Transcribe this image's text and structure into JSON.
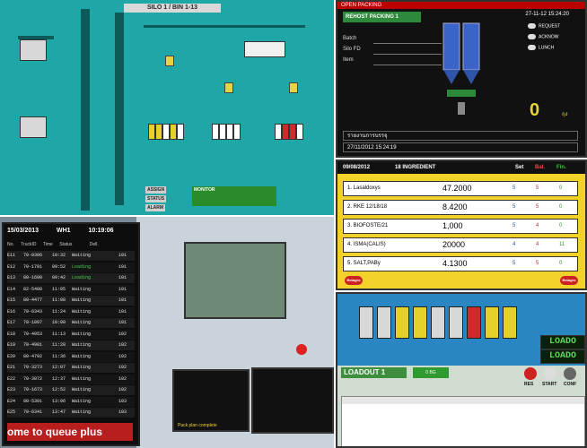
{
  "scada": {
    "title": "SILO 1 / BIN 1-13",
    "buttons": [
      "ASSIGN",
      "STATUS",
      "ALARM",
      "MONITOR"
    ],
    "hopper_colors": [
      "#e6d12a",
      "#ffffff",
      "#d02a2a",
      "#cfcfcf"
    ]
  },
  "packing": {
    "window_title": "OPEN PACKING",
    "header": "REHOST PACKING 1",
    "datetime": "27-11-12 15:24:20",
    "options": [
      "REQUEST",
      "ACKNOW",
      "LUNCH"
    ],
    "fields": [
      "Batch",
      "Silo FD",
      "Item"
    ],
    "count": "0",
    "unit": "ถุง",
    "status_label": "รายงานการบรรจุ",
    "timestamp": "27/11/2012 15:24:19"
  },
  "ingredients": {
    "date": "09/08/2012",
    "header": "18 INGREDIENT",
    "col_set": "Set",
    "col_bal": "Bal.",
    "col_fin": "Fin.",
    "rows": [
      {
        "name": "1. Lasaldoxys",
        "weight": "47.2000",
        "set": "5",
        "bal": "5",
        "fin": "0"
      },
      {
        "name": "2. RKE 12/18/18",
        "weight": "8.4200",
        "set": "5",
        "bal": "5",
        "fin": "0"
      },
      {
        "name": "3. BIOFOSTE/21",
        "weight": "1,000",
        "set": "5",
        "bal": "4",
        "fin": "0"
      },
      {
        "name": "4. ISMA(CALIS)",
        "weight": "20000",
        "set": "4",
        "bal": "4",
        "fin": "11"
      },
      {
        "name": "5. SALT,PABy",
        "weight": "4.1300",
        "set": "5",
        "bal": "5",
        "fin": "0"
      }
    ],
    "brand": "Betagro"
  },
  "queue": {
    "date": "15/03/2013",
    "warehouse": "WH1",
    "clock": "10:19:06",
    "columns": [
      "No.",
      "TruckID",
      "Time",
      "Status",
      "Dell."
    ],
    "rows": [
      {
        "no": "E11",
        "truck": "70-0306",
        "time": "10:32",
        "status": "Waiting",
        "dell": "101"
      },
      {
        "no": "E12",
        "truck": "70-1791",
        "time": "09:52",
        "status": "Loading",
        "dell": "101"
      },
      {
        "no": "E13",
        "truck": "80-1690",
        "time": "09:42",
        "status": "Loading",
        "dell": "101"
      },
      {
        "no": "E14",
        "truck": "82-5408",
        "time": "11:05",
        "status": "Waiting",
        "dell": "101"
      },
      {
        "no": "E15",
        "truck": "80-4477",
        "time": "11:08",
        "status": "Waiting",
        "dell": "101"
      },
      {
        "no": "E16",
        "truck": "70-6343",
        "time": "11:24",
        "status": "Waiting",
        "dell": "101"
      },
      {
        "no": "E17",
        "truck": "70-1097",
        "time": "10:00",
        "status": "Waiting",
        "dell": "101"
      },
      {
        "no": "E18",
        "truck": "70-4953",
        "time": "11:13",
        "status": "Waiting",
        "dell": "102"
      },
      {
        "no": "E19",
        "truck": "70-4981",
        "time": "11:28",
        "status": "Waiting",
        "dell": "102"
      },
      {
        "no": "E20",
        "truck": "80-4792",
        "time": "11:36",
        "status": "Waiting",
        "dell": "102"
      },
      {
        "no": "E21",
        "truck": "70-3273",
        "time": "12:07",
        "status": "Waiting",
        "dell": "102"
      },
      {
        "no": "E22",
        "truck": "70-3072",
        "time": "12:37",
        "status": "Waiting",
        "dell": "102"
      },
      {
        "no": "E23",
        "truck": "70-1673",
        "time": "12:52",
        "status": "Waiting",
        "dell": "102"
      },
      {
        "no": "E24",
        "truck": "80-5391",
        "time": "13:06",
        "status": "Waiting",
        "dell": "103"
      },
      {
        "no": "E25",
        "truck": "70-6341",
        "time": "13:47",
        "status": "Waiting",
        "dell": "103"
      }
    ],
    "ticker": "ome to queue plus",
    "monitor_caption": "Pack plan complete"
  },
  "loadout": {
    "title": "LOADOUT 1",
    "display1": "LOADO",
    "display2": "LOADO",
    "status": "0 BG",
    "buttons": [
      "RES",
      "START",
      "CONF"
    ],
    "bag_colors": [
      "#d8d8d8",
      "#d8d8d8",
      "#e6d12a",
      "#e6d12a",
      "#d8d8d8",
      "#d8d8d8",
      "#d02a2a",
      "#e6d12a",
      "#e6d12a"
    ]
  }
}
